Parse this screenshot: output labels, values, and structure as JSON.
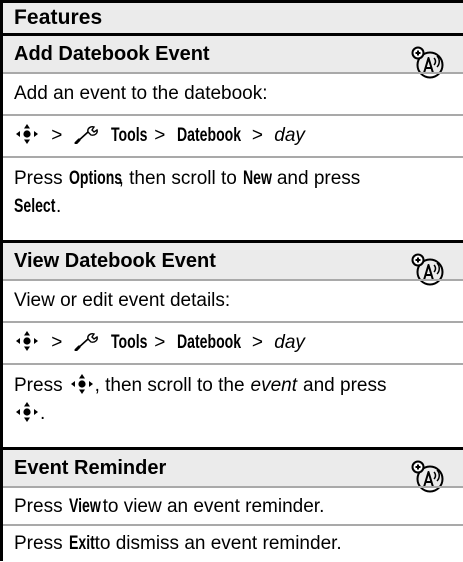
{
  "header": {
    "title": "Features"
  },
  "sections": [
    {
      "title": "Add Datebook Event",
      "icon": "network-feature-icon",
      "description": "Add an event to the datebook:",
      "path": {
        "sep1": ">",
        "tools": "Tools",
        "sep2": ">",
        "datebook": "Datebook",
        "sep3": ">",
        "day": "day"
      },
      "instruction": {
        "a": "Press",
        "options": "Options",
        "b": ", then scroll to",
        "new": "New",
        "c": "and press",
        "select": "Select",
        "d": "."
      }
    },
    {
      "title": "View Datebook Event",
      "icon": "network-feature-icon",
      "description": "View or edit event details:",
      "path": {
        "sep1": ">",
        "tools": "Tools",
        "sep2": ">",
        "datebook": "Datebook",
        "sep3": ">",
        "day": "day"
      },
      "instruction": {
        "a": "Press",
        "b": ", then scroll to the",
        "event": "event",
        "c": "and press",
        "d": "."
      }
    },
    {
      "title": "Event Reminder",
      "icon": "network-feature-icon",
      "line1": {
        "a": "Press",
        "view": "View",
        "b": "to view an event reminder."
      },
      "line2": {
        "a": "Press",
        "exit": "Exit",
        "b": "to dismiss an event reminder."
      }
    }
  ],
  "colors": {
    "header_bg": "#ebebeb",
    "rule": "#000000",
    "divider": "#a9a9a9"
  }
}
